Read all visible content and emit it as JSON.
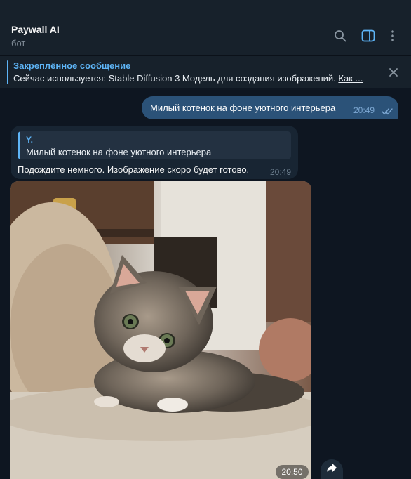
{
  "chat": {
    "title": "Paywall AI",
    "subtitle": "бот"
  },
  "header_icons": {
    "search": "search-icon",
    "sidebar": "sidebar-toggle-icon",
    "menu": "more-vertical-icon"
  },
  "pinned": {
    "title": "Закреплённое сообщение",
    "text": "Сейчас используется: Stable Diffusion 3 Модель для создания изображений.",
    "link": "Как ..."
  },
  "messages": {
    "outgoing": {
      "text": "Милый котенок на фоне уютного интерьера",
      "time": "20:49"
    },
    "incoming": {
      "reply_name": "Y.",
      "reply_text": "Милый котенок на фоне уютного интерьера",
      "text": "Подождите немного. Изображение скоро будет готово.",
      "time": "20:49"
    },
    "photo": {
      "time": "20:50"
    }
  },
  "colors": {
    "background": "#0e1621",
    "panel": "#17212b",
    "accent": "#5eb5f7",
    "outgoing_bubble": "#2b5278",
    "incoming_bubble": "#182533"
  }
}
